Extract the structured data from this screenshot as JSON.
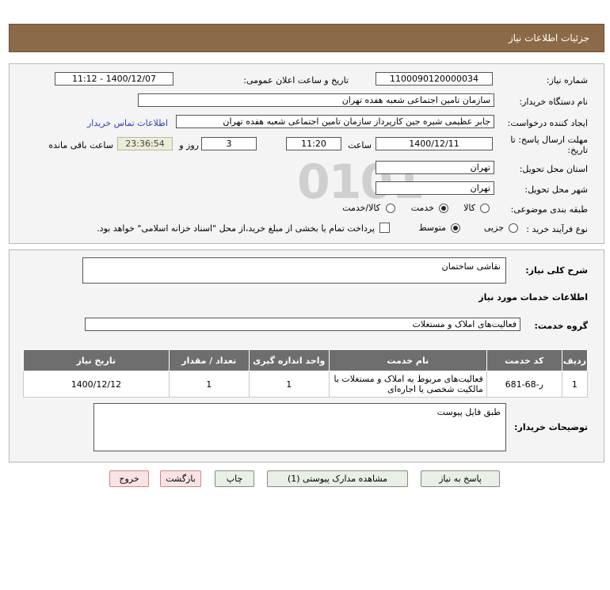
{
  "header": {
    "title": "جزئیات اطلاعات نیاز"
  },
  "form": {
    "need_number_label": "شماره نیاز:",
    "need_number": "1100090120000034",
    "announce_label": "تاریخ و ساعت اعلان عمومی:",
    "announce_value": "1400/12/07 - 11:12",
    "buyer_org_label": "نام دستگاه خریدار:",
    "buyer_org": "سازمان تامین اجتماعی شعبه هفده تهران",
    "creator_label": "ایجاد کننده درخواست:",
    "creator": "جابر عظیمی شیره جین کارپرداز  سازمان تامین اجتماعی شعبه هفده تهران",
    "contact_link": "اطلاعات تماس خریدار",
    "deadline_label_1": "مهلت ارسال پاسخ: تا",
    "deadline_label_2": "تاریخ:",
    "deadline_date": "1400/12/11",
    "time_label": "ساعت",
    "deadline_time": "11:20",
    "days_value": "3",
    "days_label": "روز و",
    "remaining_time": "23:36:54",
    "remaining_label": "ساعت باقی مانده",
    "province_label": "استان محل تحویل:",
    "province": "تهران",
    "city_label": "شهر محل تحویل:",
    "city": "تهران",
    "category_label": "طبقه بندی موضوعی:",
    "category_options": [
      "کالا",
      "خدمت",
      "کالا/خدمت"
    ],
    "category_selected": "خدمت",
    "process_label": "نوع فرآیند خرید :",
    "process_options": [
      "جزیی",
      "متوسط"
    ],
    "process_selected": "متوسط",
    "payment_note": "پرداخت تمام یا بخشی از مبلغ خرید،از محل \"اسناد خزانه اسلامی\" خواهد بود."
  },
  "details": {
    "summary_label": "شرح کلی نیاز:",
    "summary": "نقاشی ساختمان",
    "services_heading": "اطلاعات خدمات مورد نیاز",
    "service_group_label": "گروه خدمت:",
    "service_group": "فعالیت‌های  املاک و مستغلات",
    "table": {
      "headers": [
        "ردیف",
        "کد خدمت",
        "نام خدمت",
        "واحد اندازه گیری",
        "تعداد / مقدار",
        "تاریخ نیاز"
      ],
      "rows": [
        [
          "1",
          "ر-68-681",
          "فعالیت‌های مربوط به املاک و مستغلات با مالکیت شخصی یا اجاره‌ای",
          "1",
          "1",
          "1400/12/12"
        ]
      ]
    },
    "buyer_notes_label": "توضیحات خریدار:",
    "buyer_notes": "طبق فایل پیوست"
  },
  "buttons": {
    "reply": "پاسخ به نیاز",
    "view_docs": "مشاهده مدارک پیوستی (1)",
    "print": "چاپ",
    "back": "بازگشت",
    "exit": "خروج"
  }
}
